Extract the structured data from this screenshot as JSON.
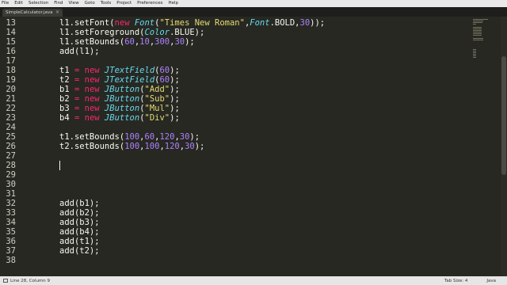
{
  "menu": {
    "items": [
      "File",
      "Edit",
      "Selection",
      "Find",
      "View",
      "Goto",
      "Tools",
      "Project",
      "Preferences",
      "Help"
    ]
  },
  "tabs": [
    {
      "label": "SimpleCalculator.java",
      "close": "×"
    }
  ],
  "editor": {
    "line_numbers": [
      "13",
      "14",
      "15",
      "16",
      "17",
      "18",
      "19",
      "20",
      "21",
      "22",
      "23",
      "24",
      "25",
      "26",
      "27",
      "28",
      "29",
      "30",
      "31",
      "32",
      "33",
      "34",
      "35",
      "36",
      "37",
      "38"
    ],
    "lines": [
      [
        {
          "t": "l1.setFont("
        },
        {
          "t": "new ",
          "c": "kw"
        },
        {
          "t": "Font",
          "c": "ty"
        },
        {
          "t": "("
        },
        {
          "t": "\"Times New Roman\"",
          "c": "st"
        },
        {
          "t": ","
        },
        {
          "t": "Font",
          "c": "ty"
        },
        {
          "t": ".BOLD,"
        },
        {
          "t": "30",
          "c": "nu"
        },
        {
          "t": "));"
        }
      ],
      [
        {
          "t": "l1.setForeground("
        },
        {
          "t": "Color",
          "c": "ty"
        },
        {
          "t": ".BLUE);"
        }
      ],
      [
        {
          "t": "l1.setBounds("
        },
        {
          "t": "60",
          "c": "nu"
        },
        {
          "t": ","
        },
        {
          "t": "10",
          "c": "nu"
        },
        {
          "t": ","
        },
        {
          "t": "300",
          "c": "nu"
        },
        {
          "t": ","
        },
        {
          "t": "30",
          "c": "nu"
        },
        {
          "t": ");"
        }
      ],
      [
        {
          "t": "add(l1);"
        }
      ],
      [],
      [
        {
          "t": "t1 "
        },
        {
          "t": "= ",
          "c": "kw"
        },
        {
          "t": "new ",
          "c": "kw"
        },
        {
          "t": "JTextField",
          "c": "ty"
        },
        {
          "t": "("
        },
        {
          "t": "60",
          "c": "nu"
        },
        {
          "t": ");"
        }
      ],
      [
        {
          "t": "t2 "
        },
        {
          "t": "= ",
          "c": "kw"
        },
        {
          "t": "new ",
          "c": "kw"
        },
        {
          "t": "JTextField",
          "c": "ty"
        },
        {
          "t": "("
        },
        {
          "t": "60",
          "c": "nu"
        },
        {
          "t": ");"
        }
      ],
      [
        {
          "t": "b1 "
        },
        {
          "t": "= ",
          "c": "kw"
        },
        {
          "t": "new ",
          "c": "kw"
        },
        {
          "t": "JButton",
          "c": "ty"
        },
        {
          "t": "("
        },
        {
          "t": "\"Add\"",
          "c": "st"
        },
        {
          "t": ");"
        }
      ],
      [
        {
          "t": "b2 "
        },
        {
          "t": "= ",
          "c": "kw"
        },
        {
          "t": "new ",
          "c": "kw"
        },
        {
          "t": "JButton",
          "c": "ty"
        },
        {
          "t": "("
        },
        {
          "t": "\"Sub\"",
          "c": "st"
        },
        {
          "t": ");"
        }
      ],
      [
        {
          "t": "b3 "
        },
        {
          "t": "= ",
          "c": "kw"
        },
        {
          "t": "new ",
          "c": "kw"
        },
        {
          "t": "JButton",
          "c": "ty"
        },
        {
          "t": "("
        },
        {
          "t": "\"Mul\"",
          "c": "st"
        },
        {
          "t": ");"
        }
      ],
      [
        {
          "t": "b4 "
        },
        {
          "t": "= ",
          "c": "kw"
        },
        {
          "t": "new ",
          "c": "kw"
        },
        {
          "t": "JButton",
          "c": "ty"
        },
        {
          "t": "("
        },
        {
          "t": "\"Div\"",
          "c": "st"
        },
        {
          "t": ");"
        }
      ],
      [],
      [
        {
          "t": "t1.setBounds("
        },
        {
          "t": "100",
          "c": "nu"
        },
        {
          "t": ","
        },
        {
          "t": "60",
          "c": "nu"
        },
        {
          "t": ","
        },
        {
          "t": "120",
          "c": "nu"
        },
        {
          "t": ","
        },
        {
          "t": "30",
          "c": "nu"
        },
        {
          "t": ");"
        }
      ],
      [
        {
          "t": "t2.setBounds("
        },
        {
          "t": "100",
          "c": "nu"
        },
        {
          "t": ","
        },
        {
          "t": "100",
          "c": "nu"
        },
        {
          "t": ","
        },
        {
          "t": "120",
          "c": "nu"
        },
        {
          "t": ","
        },
        {
          "t": "30",
          "c": "nu"
        },
        {
          "t": ");"
        }
      ],
      [],
      [],
      [],
      [],
      [],
      [
        {
          "t": "add(b1);"
        }
      ],
      [
        {
          "t": "add(b2);"
        }
      ],
      [
        {
          "t": "add(b3);"
        }
      ],
      [
        {
          "t": "add(b4);"
        }
      ],
      [
        {
          "t": "add(t1);"
        }
      ],
      [
        {
          "t": "add(t2);"
        }
      ],
      []
    ]
  },
  "status": {
    "position": "Line 28, Column 9",
    "tab_size": "Tab Size: 4",
    "syntax": "Java"
  },
  "colors": {
    "background": "#272822",
    "keyword": "#f92672",
    "type": "#66d9ef",
    "string": "#e6db74",
    "number": "#ae81ff",
    "text": "#f8f8f2"
  }
}
